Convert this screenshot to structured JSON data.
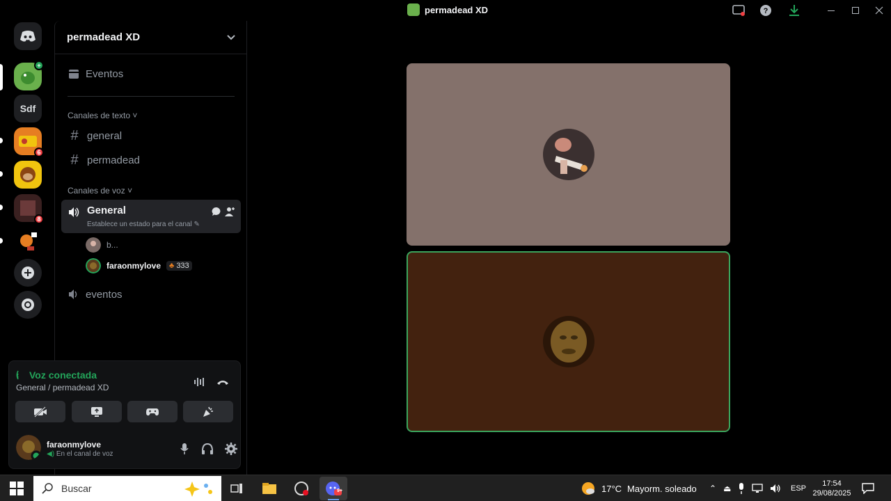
{
  "window": {
    "title": "permadead XD"
  },
  "rail": {
    "servers": [
      {
        "label": "",
        "name": "discord-home-icon"
      },
      {
        "label": "",
        "name": "permadead-xd-server",
        "badge": ""
      },
      {
        "label": "Sdf",
        "name": "sdf-server"
      },
      {
        "label": "",
        "name": "game-server",
        "badge": "6"
      },
      {
        "label": "",
        "name": "monkey-server"
      },
      {
        "label": "",
        "name": "dark-server",
        "badge": "8"
      },
      {
        "label": "",
        "name": "sonic-server"
      }
    ]
  },
  "sidebar": {
    "server_name": "permadead XD",
    "events_label": "Eventos",
    "text_category": "Canales de texto",
    "text_channels": [
      "general",
      "permadead"
    ],
    "voice_category": "Canales de voz",
    "voice_channel_active": {
      "name": "General",
      "status_hint": "Establece un estado para el canal"
    },
    "voice_users": [
      {
        "name": "b..."
      },
      {
        "name": "faraonmylove",
        "badge": "333"
      }
    ],
    "voice_channel_other": "eventos"
  },
  "voice_panel": {
    "status": "Voz conectada",
    "location": "General / permadead XD"
  },
  "user": {
    "name": "faraonmylove",
    "status": "En el canal de voz"
  },
  "taskbar": {
    "search_placeholder": "Buscar",
    "weather_temp": "17°C",
    "weather_desc": "Mayorm. soleado",
    "language": "ESP",
    "time": "17:54",
    "date": "29/08/2025",
    "app_badge": "9+"
  },
  "colors": {
    "accent_green": "#23a55a",
    "tile_top_bg": "#84716b",
    "tile_bottom_bg": "#43220f",
    "speaking_border": "#3ba55d"
  }
}
